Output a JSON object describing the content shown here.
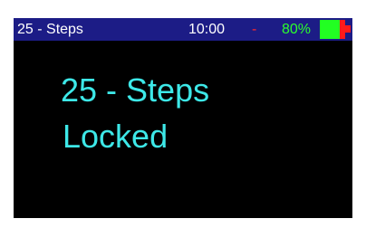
{
  "status_bar": {
    "title": "25 - Steps",
    "time": "10:00",
    "separator": "-",
    "battery_percent_label": "80%",
    "battery_level": 0.8,
    "colors": {
      "bar_background": "#1c1c86",
      "separator": "#ff2a2a",
      "battery_percent": "#2bff2b",
      "battery_charged": "#22ff22",
      "battery_empty": "#ff1a1a"
    }
  },
  "main": {
    "line_1": "25 - Steps",
    "line_2": "Locked",
    "text_color": "#3de8e8"
  }
}
